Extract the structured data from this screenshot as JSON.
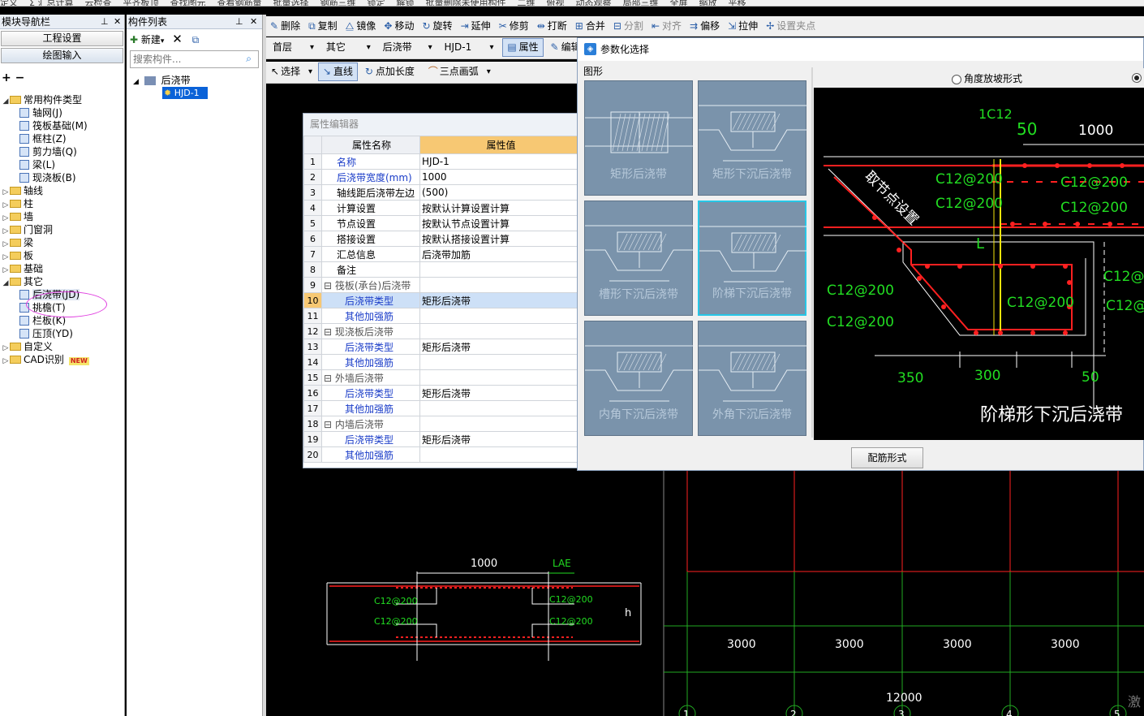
{
  "top_toolbar": [
    "定义",
    "Σ 汇总计算",
    "云检查",
    "平齐板顶",
    "查找图元",
    "查看钢筋量",
    "批量选择",
    "钢筋三维",
    "锁定",
    "解锁",
    "批量删除未使用构件",
    "二维",
    "俯视",
    "动态观察",
    "局部三维",
    "全屏",
    "缩放",
    "平移"
  ],
  "left_panel": {
    "title": "模块导航栏",
    "buttons": [
      "工程设置",
      "绘图输入"
    ],
    "tree": [
      {
        "label": "常用构件类型",
        "level": 0,
        "toggle": "◢",
        "type": "folder"
      },
      {
        "label": "轴网(J)",
        "level": 1,
        "type": "comp"
      },
      {
        "label": "筏板基础(M)",
        "level": 1,
        "type": "comp"
      },
      {
        "label": "框柱(Z)",
        "level": 1,
        "type": "comp"
      },
      {
        "label": "剪力墙(Q)",
        "level": 1,
        "type": "comp"
      },
      {
        "label": "梁(L)",
        "level": 1,
        "type": "comp"
      },
      {
        "label": "现浇板(B)",
        "level": 1,
        "type": "comp"
      },
      {
        "label": "轴线",
        "level": 0,
        "toggle": "▷",
        "type": "folder"
      },
      {
        "label": "柱",
        "level": 0,
        "toggle": "▷",
        "type": "folder"
      },
      {
        "label": "墙",
        "level": 0,
        "toggle": "▷",
        "type": "folder"
      },
      {
        "label": "门窗洞",
        "level": 0,
        "toggle": "▷",
        "type": "folder"
      },
      {
        "label": "梁",
        "level": 0,
        "toggle": "▷",
        "type": "folder"
      },
      {
        "label": "板",
        "level": 0,
        "toggle": "▷",
        "type": "folder"
      },
      {
        "label": "基础",
        "level": 0,
        "toggle": "▷",
        "type": "folder"
      },
      {
        "label": "其它",
        "level": 0,
        "toggle": "◢",
        "type": "folder"
      },
      {
        "label": "后浇带(JD)",
        "level": 1,
        "type": "comp",
        "highlight": true
      },
      {
        "label": "挑檐(T)",
        "level": 1,
        "type": "comp"
      },
      {
        "label": "栏板(K)",
        "level": 1,
        "type": "comp"
      },
      {
        "label": "压顶(YD)",
        "level": 1,
        "type": "comp"
      },
      {
        "label": "自定义",
        "level": 0,
        "toggle": "▷",
        "type": "folder"
      },
      {
        "label": "CAD识别",
        "level": 0,
        "toggle": "▷",
        "type": "folder",
        "badge": "NEW"
      }
    ]
  },
  "component_list": {
    "title": "构件列表",
    "new_label": "新建",
    "search_placeholder": "搜索构件...",
    "tree_root": "后浇带",
    "tree_item": "HJD-1"
  },
  "toolbar1": [
    "删除",
    "复制",
    "镜像",
    "移动",
    "旋转",
    "延伸",
    "修剪",
    "打断",
    "合并",
    "分割",
    "对齐",
    "偏移",
    "拉伸",
    "设置夹点"
  ],
  "toolbar2": {
    "floor": "首层",
    "category": "其它",
    "component_type": "后浇带",
    "component": "HJD-1",
    "attr_btn": "属性",
    "edit_btn": "编辑"
  },
  "toolbar3": {
    "select": "选择",
    "line": "直线",
    "point_length": "点加长度",
    "arc": "三点画弧"
  },
  "property_editor": {
    "title": "属性编辑器",
    "col_name": "属性名称",
    "col_value": "属性值",
    "rows": [
      {
        "n": "1",
        "name": "名称",
        "value": "HJD-1",
        "blue": true
      },
      {
        "n": "2",
        "name": "后浇带宽度(mm)",
        "value": "1000",
        "blue": true
      },
      {
        "n": "3",
        "name": "轴线距后浇带左边",
        "value": "(500)"
      },
      {
        "n": "4",
        "name": "计算设置",
        "value": "按默认计算设置计算"
      },
      {
        "n": "5",
        "name": "节点设置",
        "value": "按默认节点设置计算"
      },
      {
        "n": "6",
        "name": "搭接设置",
        "value": "按默认搭接设置计算"
      },
      {
        "n": "7",
        "name": "汇总信息",
        "value": "后浇带加筋"
      },
      {
        "n": "8",
        "name": "备注",
        "value": ""
      },
      {
        "n": "9",
        "name": "筏板(承台)后浇带",
        "value": "",
        "group": true
      },
      {
        "n": "10",
        "name": "后浇带类型",
        "value": "矩形后浇带",
        "blue": true,
        "sel": true,
        "indent": true
      },
      {
        "n": "11",
        "name": "其他加强筋",
        "value": "",
        "blue": true,
        "indent": true
      },
      {
        "n": "12",
        "name": "现浇板后浇带",
        "value": "",
        "group": true
      },
      {
        "n": "13",
        "name": "后浇带类型",
        "value": "矩形后浇带",
        "blue": true,
        "indent": true
      },
      {
        "n": "14",
        "name": "其他加强筋",
        "value": "",
        "blue": true,
        "indent": true
      },
      {
        "n": "15",
        "name": "外墙后浇带",
        "value": "",
        "group": true
      },
      {
        "n": "16",
        "name": "后浇带类型",
        "value": "矩形后浇带",
        "blue": true,
        "indent": true
      },
      {
        "n": "17",
        "name": "其他加强筋",
        "value": "",
        "blue": true,
        "indent": true
      },
      {
        "n": "18",
        "name": "内墙后浇带",
        "value": "",
        "group": true
      },
      {
        "n": "19",
        "name": "后浇带类型",
        "value": "矩形后浇带",
        "blue": true,
        "indent": true
      },
      {
        "n": "20",
        "name": "其他加强筋",
        "value": "",
        "blue": true,
        "indent": true
      }
    ]
  },
  "dialog": {
    "title": "参数化选择",
    "group_label": "图形",
    "tiles": [
      "矩形后浇带",
      "矩形下沉后浇带",
      "槽形下沉后浇带",
      "阶梯下沉后浇带",
      "内角下沉后浇带",
      "外角下沉后浇带"
    ],
    "selected_tile": 3,
    "radio_angle": "角度放坡形式",
    "preview_title": "阶梯形下沉后浇带",
    "preview_labels": {
      "top_bar": "1C12",
      "d50a": "50",
      "d1000": "1000",
      "node": "取节点设置",
      "rebar": "C12@200",
      "L": "L",
      "d350": "350",
      "d300": "300",
      "d50b": "50",
      "right_partial": "C12@2"
    },
    "button": "配筋形式"
  },
  "canvas": {
    "dim_1000": "1000",
    "lae": "LAE",
    "rebar": "C12@200",
    "h": "h",
    "grid_dims": [
      "3000",
      "3000",
      "3000",
      "3000"
    ],
    "grid_total": "12000",
    "axis_nums": [
      "1",
      "2",
      "3",
      "4",
      "5"
    ],
    "watermark": "激"
  },
  "colors": {
    "accent": "#27c6e6",
    "tile": "#7a93ab",
    "cad_green": "#22dd22",
    "cad_red": "#ff2020",
    "cad_yellow": "#f4e40c"
  }
}
